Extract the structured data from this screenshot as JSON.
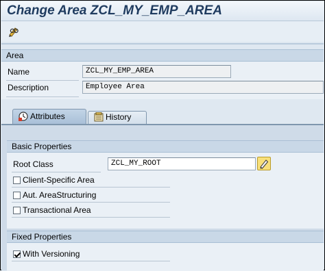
{
  "title": "Change Area ZCL_MY_EMP_AREA",
  "toolbar": {
    "display_change_icon": "pencil-glasses-icon"
  },
  "area_group": {
    "header": "Area",
    "name_label": "Name",
    "name_value": "ZCL_MY_EMP_AREA",
    "description_label": "Description",
    "description_value": "Employee Area"
  },
  "tabs": [
    {
      "label": "Attributes",
      "icon": "attributes-icon",
      "active": true
    },
    {
      "label": "History",
      "icon": "history-icon",
      "active": false
    }
  ],
  "basic_properties": {
    "header": "Basic Properties",
    "root_class_label": "Root Class",
    "root_class_value": "ZCL_MY_ROOT",
    "checkboxes": [
      {
        "label": "Client-Specific Area",
        "checked": false
      },
      {
        "label": "Aut. AreaStructuring",
        "checked": false
      },
      {
        "label": "Transactional Area",
        "checked": false
      }
    ]
  },
  "fixed_properties": {
    "header": "Fixed Properties",
    "checkboxes": [
      {
        "label": "With Versioning",
        "checked": true
      }
    ]
  }
}
